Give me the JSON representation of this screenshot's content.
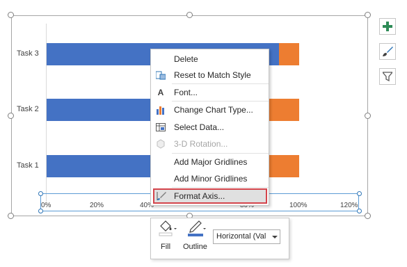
{
  "chart": {
    "categories": [
      "Task 3",
      "Task 2",
      "Task 1"
    ],
    "x_ticks": [
      "0%",
      "20%",
      "40%",
      "80%",
      "100%",
      "120%"
    ],
    "bars": [
      {
        "category": "Task 3",
        "blue": 0.93,
        "orange": 0.07
      },
      {
        "category": "Task 2",
        "blue": 0.82,
        "orange": 0.18
      },
      {
        "category": "Task 1",
        "blue": 0.82,
        "orange": 0.18
      }
    ],
    "colors": {
      "blue": "#4472c4",
      "orange": "#ed7d31"
    }
  },
  "side_buttons": [
    {
      "icon": "plus-icon",
      "color": "#2e8b57"
    },
    {
      "icon": "brush-icon",
      "color": "#2e75b6"
    },
    {
      "icon": "filter-icon",
      "color": "#595959"
    }
  ],
  "context_menu": {
    "items": [
      {
        "label": "Delete",
        "icon": ""
      },
      {
        "label": "Reset to Match Style",
        "icon": "reset-style-icon"
      },
      {
        "label": "Font...",
        "icon": "font-icon"
      },
      {
        "label": "Change Chart Type...",
        "icon": "chart-type-icon"
      },
      {
        "label": "Select Data...",
        "icon": "select-data-icon"
      },
      {
        "label": "3-D Rotation...",
        "icon": "rotation-icon"
      },
      {
        "label": "Add Major Gridlines",
        "icon": ""
      },
      {
        "label": "Add Minor Gridlines",
        "icon": ""
      },
      {
        "label": "Format Axis...",
        "icon": "format-axis-icon"
      }
    ]
  },
  "mini_toolbar": {
    "fill_label": "Fill",
    "outline_label": "Outline",
    "selector_value": "Horizontal (Val"
  }
}
